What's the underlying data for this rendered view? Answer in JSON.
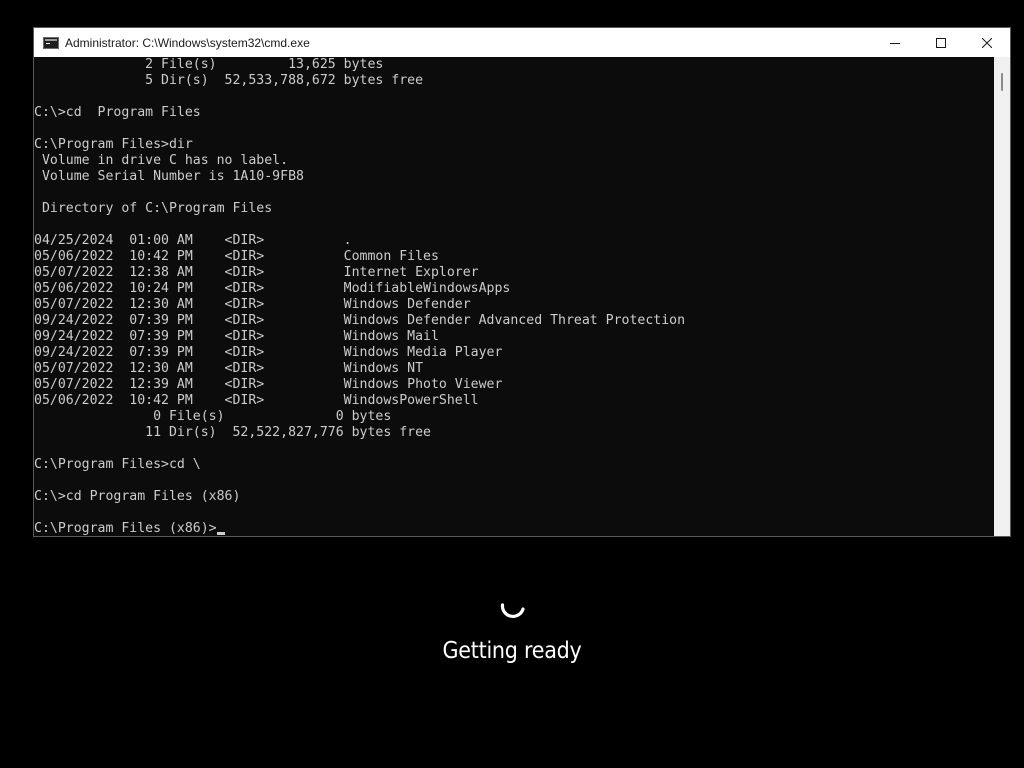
{
  "window": {
    "title": "Administrator: C:\\Windows\\system32\\cmd.exe",
    "icon": "cmd-icon",
    "buttons": [
      "minimize-icon",
      "maximize-icon",
      "close-icon"
    ]
  },
  "console": {
    "text_color": "#cccccc",
    "background": "#0c0c0c",
    "lines": [
      "              2 File(s)         13,625 bytes",
      "              5 Dir(s)  52,533,788,672 bytes free",
      "",
      "C:\\>cd  Program Files",
      "",
      "C:\\Program Files>dir",
      " Volume in drive C has no label.",
      " Volume Serial Number is 1A10-9FB8",
      "",
      " Directory of C:\\Program Files",
      "",
      "04/25/2024  01:00 AM    <DIR>          .",
      "05/06/2022  10:42 PM    <DIR>          Common Files",
      "05/07/2022  12:38 AM    <DIR>          Internet Explorer",
      "05/06/2022  10:24 PM    <DIR>          ModifiableWindowsApps",
      "05/07/2022  12:30 AM    <DIR>          Windows Defender",
      "09/24/2022  07:39 PM    <DIR>          Windows Defender Advanced Threat Protection",
      "09/24/2022  07:39 PM    <DIR>          Windows Mail",
      "09/24/2022  07:39 PM    <DIR>          Windows Media Player",
      "05/07/2022  12:30 AM    <DIR>          Windows NT",
      "05/07/2022  12:39 AM    <DIR>          Windows Photo Viewer",
      "05/06/2022  10:42 PM    <DIR>          WindowsPowerShell",
      "               0 File(s)              0 bytes",
      "              11 Dir(s)  52,522,827,776 bytes free",
      "",
      "C:\\Program Files>cd \\",
      "",
      "C:\\>cd Program Files (x86)",
      ""
    ],
    "prompt": "C:\\Program Files (x86)>"
  },
  "overlay": {
    "spinner_icon": "spinner-icon",
    "status_text": "Getting ready",
    "text_color": "#ffffff"
  }
}
